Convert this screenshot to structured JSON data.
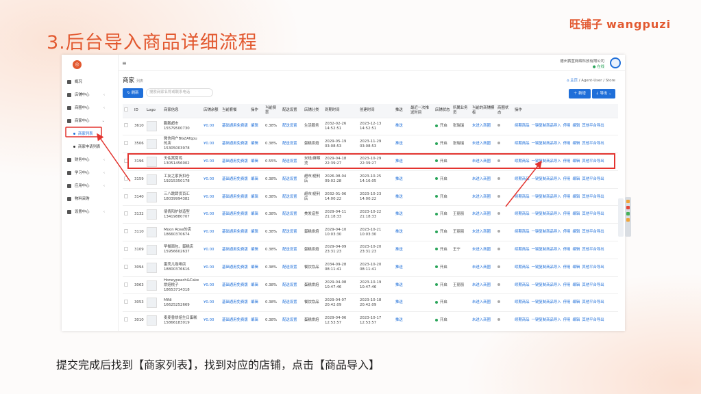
{
  "slide": {
    "title": "3.后台导入商品详细流程",
    "brand_cn": "旺铺子",
    "brand_en": "wangpuzi",
    "caption": "提交完成后找到【商家列表】，找到对应的店铺，点击【商品导入】"
  },
  "sidebar": {
    "logo": "◎",
    "items": [
      {
        "label": "概况",
        "icon": "dashboard-icon",
        "arrow": ""
      },
      {
        "label": "店铺中心",
        "icon": "store-icon",
        "arrow": "‹"
      },
      {
        "label": "商圈中心",
        "icon": "district-icon",
        "arrow": "‹"
      },
      {
        "label": "商家中心",
        "icon": "merchant-icon",
        "arrow": "⌄"
      },
      {
        "label": "商家列表",
        "sub": true,
        "active": true
      },
      {
        "label": "商家申请列表",
        "sub": true
      },
      {
        "label": "财务中心",
        "icon": "finance-icon",
        "arrow": "‹"
      },
      {
        "label": "学习中心",
        "icon": "study-icon",
        "arrow": "‹"
      },
      {
        "label": "应用中心",
        "icon": "apps-icon",
        "arrow": "‹"
      },
      {
        "label": "物料采购",
        "icon": "purchase-icon",
        "arrow": ""
      },
      {
        "label": "设置中心",
        "icon": "settings-icon",
        "arrow": "‹"
      }
    ]
  },
  "topbar": {
    "menu_icon": "≡",
    "company": "德州赛荳网络科技有限公司",
    "status": "● 在线"
  },
  "page": {
    "title": "商家",
    "subtitle": "列表",
    "crumbs": {
      "home": "⌂ 主页",
      "path": "/  Agent-User  /  Store"
    }
  },
  "toolbar": {
    "refresh": "↻ 刷新",
    "search_placeholder": "搜索商家名称或联系电话",
    "add": "＋ 新增",
    "export": "↓ 导出  ⌄"
  },
  "table": {
    "headers": [
      "",
      "ID",
      "Logo",
      "商家信息",
      "店铺余额",
      "当前套餐",
      "操作",
      "当前费率",
      "配送设置",
      "店铺分类",
      "到期时间",
      "创建时间",
      "推送",
      "最近一次推送时间",
      "店铺状态",
      "所属业务员",
      "当前的商铺模板",
      "商圈状态",
      "操作"
    ],
    "cell_labels": {
      "plan": "基础通用免费版",
      "op": "编辑",
      "delivery": "配送设置",
      "push": "推送",
      "template": "未进入商圈",
      "status": "开启",
      "a1": "续期商品",
      "a2": "一键复制商品导入",
      "a3": "停用",
      "a4": "编辑",
      "a5": "其他平台导出"
    },
    "rows": [
      {
        "id": "3610",
        "name": "鹏鹏超市",
        "phone": "15579500730",
        "balance": "¥0.00",
        "rate": "0.38%",
        "category": "生活服务",
        "expire": "2032-02-26 14:52:51",
        "created": "2023-12-13 14:52:51",
        "salesman": "张瑞瑞"
      },
      {
        "id": "3506",
        "name": "微信用户BGZAfqpu的店",
        "phone": "15305003978",
        "balance": "¥0.00",
        "rate": "0.38%",
        "category": "蛋糕烘焙",
        "expire": "2029-05-19 03:08:53",
        "created": "2023-11-29 03:08:53",
        "salesman": "张瑞瑞"
      },
      {
        "id": "3196",
        "name": "天佑窝窝鸡",
        "phone": "13051456002",
        "balance": "¥0.00",
        "rate": "0.55%",
        "category": "米线/麻辣烫",
        "expire": "2029-04-18 22:39:27",
        "created": "2023-10-29 22:39:27",
        "salesman": ""
      },
      {
        "id": "3159",
        "name": "工友之家折扣仓",
        "phone": "19215350178",
        "balance": "¥0.00",
        "rate": "0.38%",
        "category": "超市/便利店",
        "expire": "2026-08-04 09:02:28",
        "created": "2023-10-25 14:16:05",
        "salesman": ""
      },
      {
        "id": "3140",
        "name": "三八跳蹄货百汇",
        "phone": "18039994382",
        "balance": "¥0.00",
        "rate": "0.38%",
        "category": "超市/便利店",
        "expire": "2032-01-06 14:00:22",
        "created": "2023-10-23 14:00:22",
        "salesman": ""
      },
      {
        "id": "3132",
        "name": "倩倩阳护肤造型",
        "phone": "13419880707",
        "balance": "¥0.00",
        "rate": "0.38%",
        "category": "美发造型",
        "expire": "2029-04-11 21:18:33",
        "created": "2023-10-22 21:18:33",
        "salesman": "王丽丽"
      },
      {
        "id": "3110",
        "name": "Moon Rose的店",
        "phone": "18660370674",
        "balance": "¥0.00",
        "rate": "0.38%",
        "category": "蛋糕烘焙",
        "expire": "2029-04-10 10:03:30",
        "created": "2023-10-21 10:03:30",
        "salesman": "王丽丽"
      },
      {
        "id": "3109",
        "name": "早餐面包，蛋糕店",
        "phone": "15956602637",
        "balance": "¥0.00",
        "rate": "0.38%",
        "category": "蛋糕烘焙",
        "expire": "2029-04-09 23:31:23",
        "created": "2023-10-20 23:31:23",
        "salesman": "王宁"
      },
      {
        "id": "3094",
        "name": "蛋壳儿咖啡店",
        "phone": "18800376616",
        "balance": "¥0.00",
        "rate": "0.38%",
        "category": "餐饮饮品",
        "expire": "2034-09-28 08:11:41",
        "created": "2023-10-20 08:11:41",
        "salesman": ""
      },
      {
        "id": "3063",
        "name": "Honeypeach&Cake烘焙桃子",
        "phone": "18653714318",
        "balance": "¥0.00",
        "rate": "0.38%",
        "category": "蛋糕烘焙",
        "expire": "2029-04-08 10:47:46",
        "created": "2023-10-19 10:47:46",
        "salesman": "王丽丽"
      },
      {
        "id": "3053",
        "name": "MiNi",
        "phone": "16625252669",
        "balance": "¥0.00",
        "rate": "0.38%",
        "category": "餐饮饮品",
        "expire": "2029-04-07 20:42:09",
        "created": "2023-10-18 20:42:09",
        "salesman": ""
      },
      {
        "id": "3010",
        "name": "麦麦香烘焙生日蛋糕",
        "phone": "15866183019",
        "balance": "¥0.00",
        "rate": "0.38%",
        "category": "蛋糕烘焙",
        "expire": "2029-04-06 12:53:57",
        "created": "2023-10-17 12:53:57",
        "salesman": ""
      }
    ]
  },
  "colors": {
    "accent": "#1f6fd9",
    "brand": "#e2582f",
    "highlight": "#e3342f",
    "status_on": "#2aa55a"
  }
}
